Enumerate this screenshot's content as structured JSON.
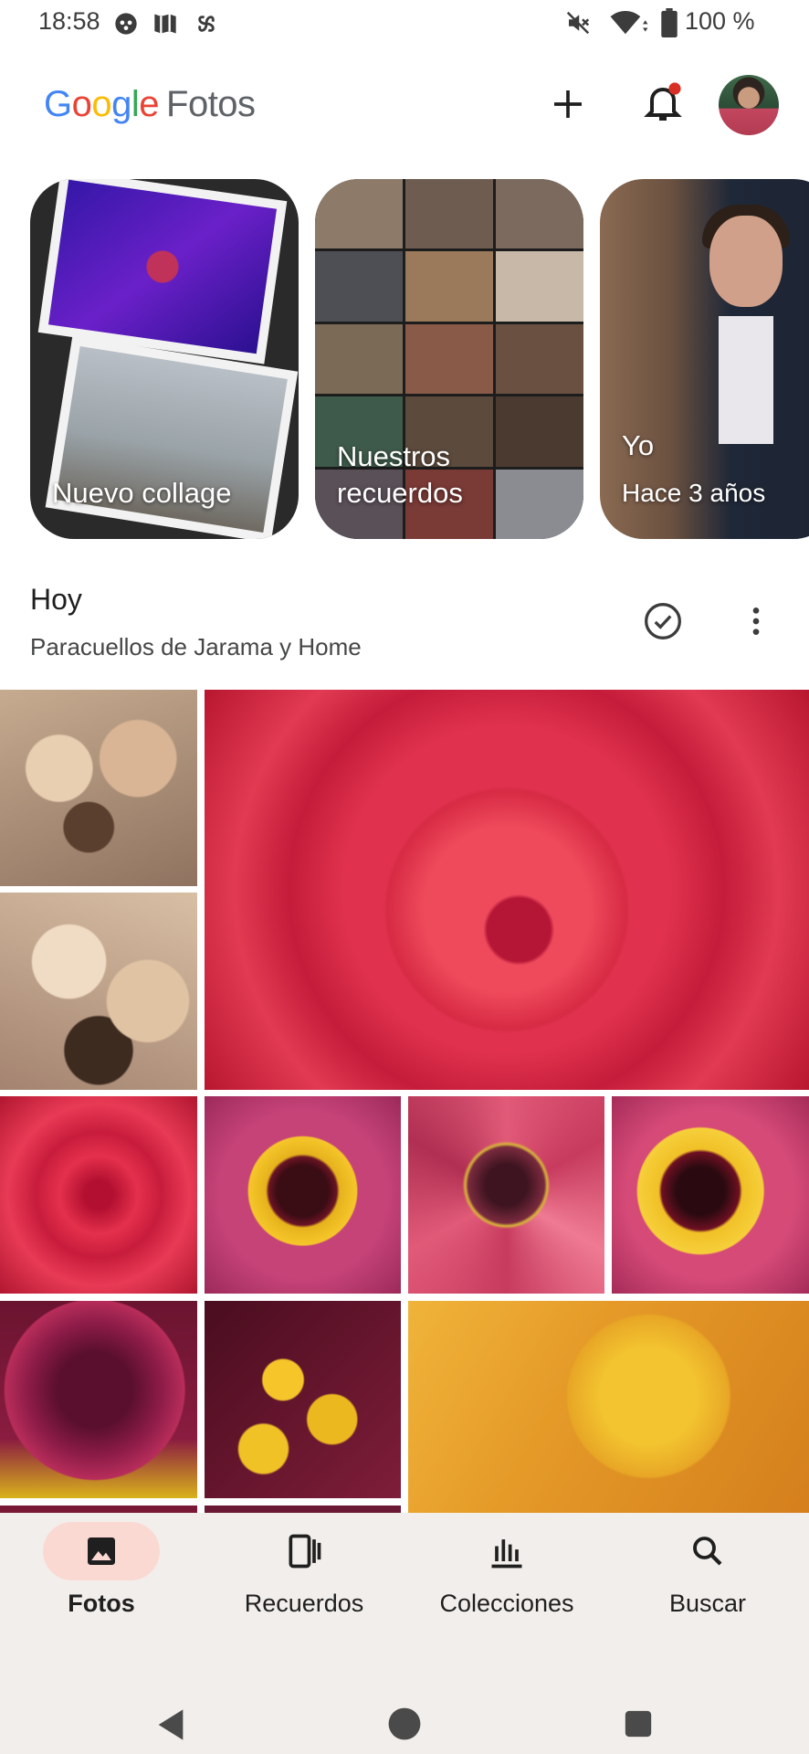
{
  "status_bar": {
    "time": "18:58",
    "battery_pct": "100 %",
    "icons": [
      "ghost-icon",
      "maps-icon",
      "pinwheel-icon",
      "mute-icon",
      "wifi-icon",
      "battery-icon"
    ]
  },
  "header": {
    "logo_letters": [
      "G",
      "o",
      "o",
      "g",
      "l",
      "e"
    ],
    "app_name": "Fotos",
    "actions": [
      "add-icon",
      "notifications-icon"
    ],
    "notification_dot_color": "#ea4335"
  },
  "memories": [
    {
      "label": "Nuevo collage"
    },
    {
      "label_line1": "Nuestros",
      "label_line2": "recuerdos"
    },
    {
      "title": "Yo",
      "subtitle": "Hace 3 años"
    }
  ],
  "section": {
    "title": "Hoy",
    "location": "Paracuellos de Jarama y Home"
  },
  "photos": [
    "crumb-photo",
    "crumb-photo",
    "rose-photo",
    "rose-photo",
    "zinnia-photo",
    "zinnia-photo",
    "zinnia-photo",
    "zinnia-photo",
    "zinnia-photo",
    "pollen-photo"
  ],
  "nav": {
    "items": [
      {
        "label": "Fotos",
        "icon": "photo-icon",
        "active": true
      },
      {
        "label": "Recuerdos",
        "icon": "memories-icon",
        "active": false
      },
      {
        "label": "Colecciones",
        "icon": "collections-icon",
        "active": false
      },
      {
        "label": "Buscar",
        "icon": "search-icon",
        "active": false
      }
    ],
    "active_color": "#fbd9d3"
  },
  "system_nav": [
    "back-icon",
    "home-icon",
    "recents-icon"
  ]
}
